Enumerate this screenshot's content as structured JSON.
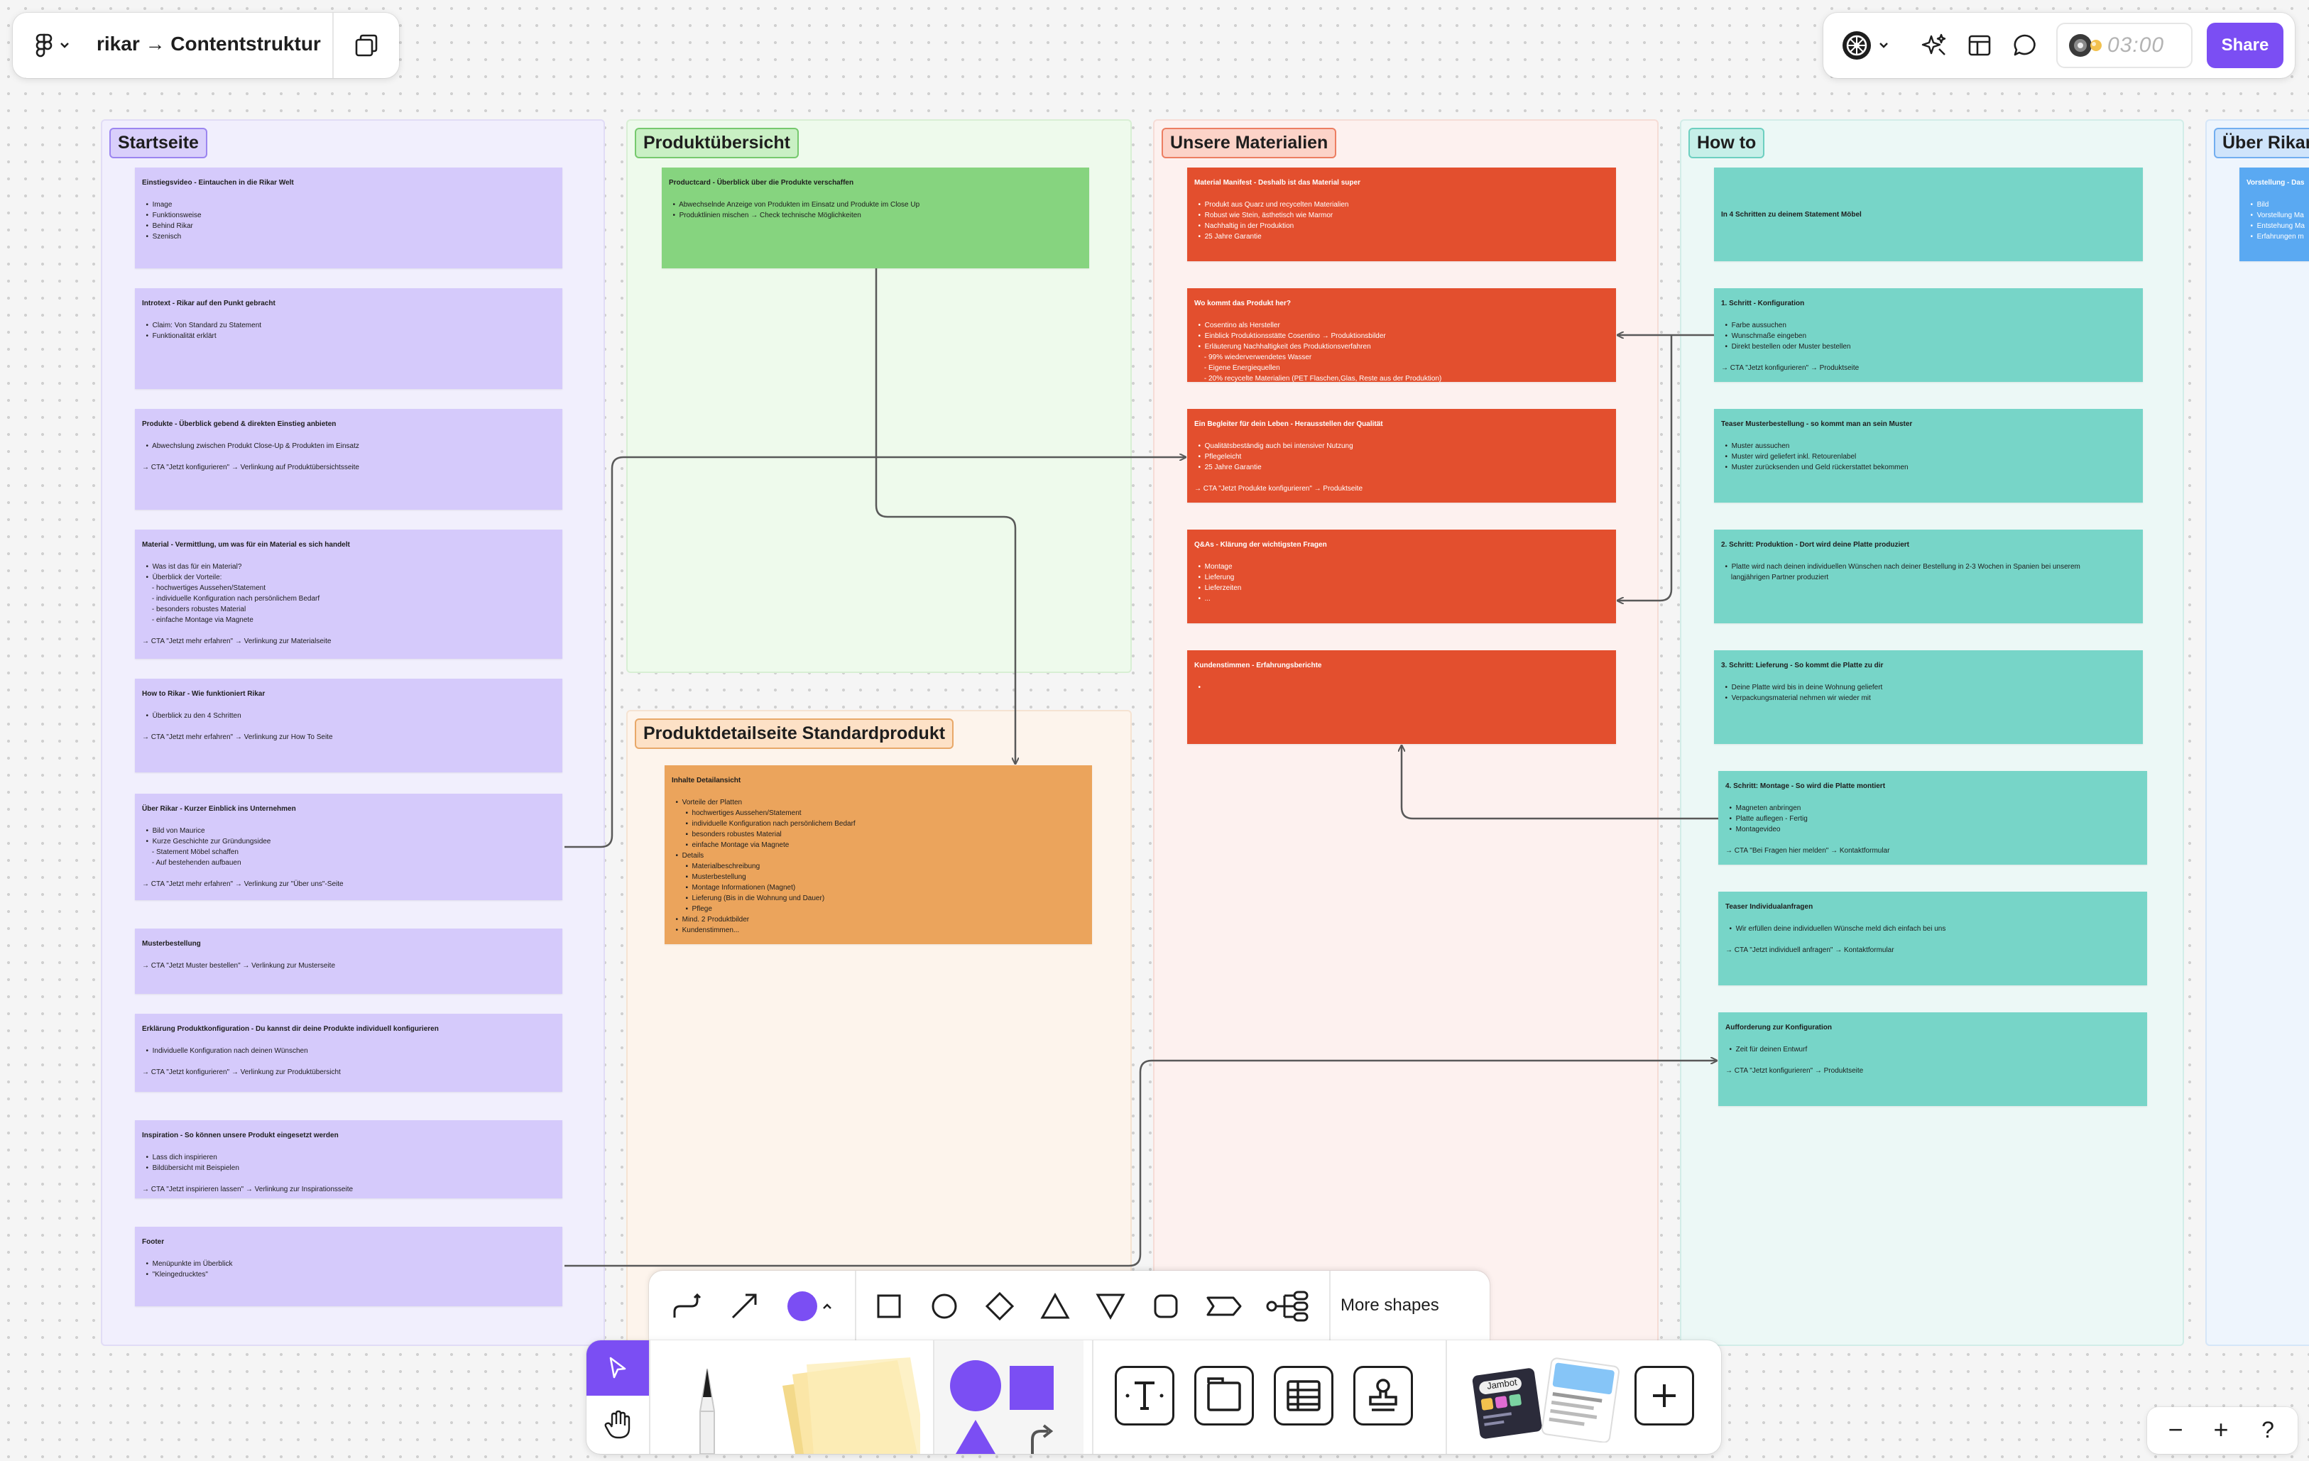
{
  "file_title": "rikar → Contentstruktur",
  "timer": "03:00",
  "share_label": "Share",
  "icons": {
    "figma": "figma-logo-icon",
    "pages": "pages-icon",
    "ai": "ai-sparkle-icon",
    "layout": "layout-icon",
    "comment": "comment-icon",
    "timer": "timer-icon"
  },
  "sections": {
    "startseite": "Startseite",
    "produktuebersicht": "Produktübersicht",
    "produktdetail": "Produktdetailseite Standardprodukt",
    "materialien": "Unsere Materialien",
    "howto": "How to",
    "ueber": "Über Rikar"
  },
  "cards": {
    "s1": {
      "title": "Einstiegsvideo - Eintauchen in die Rikar Welt",
      "lines": [
        "  •  Image",
        "  •  Funktionsweise",
        "  •  Behind Rikar",
        "  •  Szenisch"
      ]
    },
    "s2": {
      "title": "Introtext - Rikar auf den Punkt gebracht",
      "lines": [
        "  •  Claim: Von Standard zu Statement",
        "  •  Funktionalität erklärt"
      ]
    },
    "s3": {
      "title": "Produkte - Überblick gebend & direkten Einstieg anbieten",
      "lines": [
        "  •  Abwechslung zwischen Produkt Close-Up & Produkten im Einsatz",
        "",
        "→ CTA \"Jetzt konfigurieren\" → Verlinkung auf Produktübersichtsseite"
      ]
    },
    "s4": {
      "title": "Material - Vermittlung, um was für ein Material es sich handelt",
      "lines": [
        "  •  Was ist das für ein Material?",
        "  •  Überblick der Vorteile:",
        "     - hochwertiges Aussehen/Statement",
        "     - individuelle Konfiguration nach persönlichem Bedarf",
        "     - besonders robustes Material",
        "     - einfache Montage via Magnete",
        "",
        "→ CTA \"Jetzt mehr erfahren\" → Verlinkung zur Materialseite"
      ]
    },
    "s5": {
      "title": "How to Rikar - Wie funktioniert Rikar",
      "lines": [
        "  •  Überblick zu den 4 Schritten",
        "",
        "→ CTA \"Jetzt mehr erfahren\" → Verlinkung zur How To Seite"
      ]
    },
    "s6": {
      "title": "Über Rikar - Kurzer Einblick ins Unternehmen",
      "lines": [
        "  •  Bild von Maurice",
        "  •  Kurze Geschichte zur Gründungsidee",
        "     - Statement Möbel schaffen",
        "     - Auf bestehenden aufbauen",
        "",
        "→ CTA \"Jetzt mehr erfahren\" → Verlinkung zur \"Über uns\"-Seite"
      ]
    },
    "s7": {
      "title": "Musterbestellung",
      "lines": [
        "→ CTA \"Jetzt Muster bestellen\" → Verlinkung zur Musterseite"
      ]
    },
    "s8": {
      "title": "Erklärung Produktkonfiguration - Du kannst dir deine Produkte individuell konfigurieren",
      "lines": [
        "  •  Individuelle Konfiguration nach deinen Wünschen",
        "",
        "→ CTA \"Jetzt konfigurieren\" → Verlinkung zur Produktübersicht"
      ]
    },
    "s9": {
      "title": "Inspiration - So können unsere Produkt eingesetzt werden",
      "lines": [
        "  •  Lass dich inspirieren",
        "  •  Bildübersicht mit Beispielen",
        "",
        "→ CTA \"Jetzt inspirieren lassen\" → Verlinkung zur Inspirationsseite"
      ]
    },
    "s10": {
      "title": "Footer",
      "lines": [
        "  •  Menüpunkte im Überblick",
        "  •  \"Kleingedrucktes\""
      ]
    },
    "p1": {
      "title": "Productcard - Überblick über die Produkte verschaffen",
      "lines": [
        "  •  Abwechselnde Anzeige von Produkten im Einsatz und Produkte im Close Up",
        "  •  Produktlinien mischen → Check technische Möglichkeiten"
      ]
    },
    "d1": {
      "title": "Inhalte Detailansicht",
      "lines": [
        "  •  Vorteile der Platten",
        "       ▪  hochwertiges Aussehen/Statement",
        "       ▪  individuelle Konfiguration nach persönlichem Bedarf",
        "       ▪  besonders robustes Material",
        "       ▪  einfache Montage via Magnete",
        "  •  Details",
        "       ▪  Materialbeschreibung",
        "       ▪  Musterbestellung",
        "       ▪  Montage Informationen (Magnet)",
        "       ▪  Lieferung (Bis in die Wohnung und Dauer)",
        "       ▪  Pflege",
        "  •  Mind. 2 Produktbilder",
        "  •  Kundenstimmen..."
      ]
    },
    "m1": {
      "title": "Material Manifest - Deshalb ist das Material super",
      "lines": [
        "  •  Produkt aus Quarz und recycelten Materialien",
        "  •  Robust wie Stein, ästhetisch wie Marmor",
        "  •  Nachhaltig in der Produktion",
        "  •  25 Jahre Garantie"
      ]
    },
    "m2": {
      "title": "Wo kommt das Produkt her?",
      "lines": [
        "  •  Cosentino als Hersteller",
        "  •  Einblick Produktionsstätte Cosentino → Produktionsbilder",
        "  •  Erläuterung Nachhaltigkeit des Produktionsverfahren",
        "     - 99% wiederverwendetes Wasser",
        "     - Eigene Energiequellen",
        "     - 20% recycelte Materialien (PET Flaschen,Glas, Reste aus der Produktion)"
      ]
    },
    "m3": {
      "title": "Ein Begleiter für dein Leben - Herausstellen der Qualität",
      "lines": [
        "  •  Qualitätsbeständig auch bei intensiver Nutzung",
        "  •  Pflegeleicht",
        "  •  25 Jahre Garantie",
        "",
        "→ CTA \"Jetzt Produkte konfigurieren\" → Produktseite"
      ]
    },
    "m4": {
      "title": "Q&As - Klärung der wichtigsten Fragen",
      "lines": [
        "  •  Montage",
        "  •  Lieferung",
        "  •  Lieferzeiten",
        "  •  ..."
      ]
    },
    "m5": {
      "title": "Kundenstimmen - Erfahrungsberichte",
      "lines": [
        "  •  "
      ]
    },
    "h1": {
      "title": "In 4 Schritten zu deinem Statement Möbel",
      "lines": []
    },
    "h2": {
      "title": "1. Schritt - Konfiguration",
      "lines": [
        "  •  Farbe aussuchen",
        "  •  Wunschmaße eingeben",
        "  •  Direkt bestellen oder Muster bestellen",
        "",
        "→ CTA \"Jetzt konfigurieren\" → Produktseite"
      ]
    },
    "h3": {
      "title": "Teaser Musterbestellung - so kommt man an sein Muster",
      "lines": [
        "  •  Muster aussuchen",
        "  •  Muster wird geliefert inkl. Retourenlabel",
        "  •  Muster zurücksenden und Geld rückerstattet bekommen"
      ]
    },
    "h4": {
      "title": "2. Schritt: Produktion - Dort wird deine Platte produziert",
      "lines": [
        "  •  Platte wird nach deinen individuellen Wünschen nach deiner Bestellung in 2-3 Wochen in Spanien bei unserem",
        "     langjährigen Partner produziert"
      ]
    },
    "h5": {
      "title": "3. Schritt: Lieferung - So kommt die Platte zu dir",
      "lines": [
        "  •  Deine Platte wird bis in deine Wohnung geliefert",
        "  •  Verpackungsmaterial nehmen wir wieder mit"
      ]
    },
    "h6": {
      "title": "4. Schritt: Montage - So wird die Platte montiert",
      "lines": [
        "  •  Magneten anbringen",
        "  •  Platte auflegen - Fertig",
        "  •  Montagevideo",
        "",
        "→ CTA \"Bei Fragen hier melden\" → Kontaktformular"
      ]
    },
    "h7": {
      "title": "Teaser Individualanfragen",
      "lines": [
        "  •  Wir erfüllen deine individuellen Wünsche meld dich einfach bei uns",
        "",
        "→ CTA \"Jetzt individuell anfragen\" → Kontaktformular"
      ]
    },
    "h8": {
      "title": "Aufforderung zur Konfiguration",
      "lines": [
        "  •  Zeit für deinen Entwurf",
        "",
        "→ CTA \"Jetzt konfigurieren\" → Produktseite"
      ]
    },
    "u1": {
      "title": "Vorstellung - Das",
      "lines": [
        "  •  Bild",
        "  •  Vorstellung Ma",
        "  •  Entstehung Ma",
        "  •  Erfahrungen m"
      ]
    }
  },
  "toolbar": {
    "more_shapes": "More shapes",
    "fill_color": "#7b4ef3",
    "shape_tools": [
      "connector-elbow-icon",
      "connector-straight-icon",
      "color-swatch",
      "square-icon",
      "circle-icon",
      "diamond-icon",
      "triangle-icon",
      "triangle-down-icon",
      "rounded-square-icon",
      "chevron-shape-icon",
      "mind-map-icon"
    ],
    "bottom_tools": [
      "move-tool-icon",
      "hand-tool-icon",
      "marker-pen-icon",
      "sticky-note-icon",
      "shapes-icon",
      "text-tool-icon",
      "section-tool-icon",
      "table-tool-icon",
      "stamp-tool-icon",
      "jambot-widgets-icon",
      "add-more-icon"
    ],
    "jambot_label": "Jambot"
  },
  "zoom_controls": {
    "minus": "−",
    "plus": "+",
    "help": "?"
  }
}
